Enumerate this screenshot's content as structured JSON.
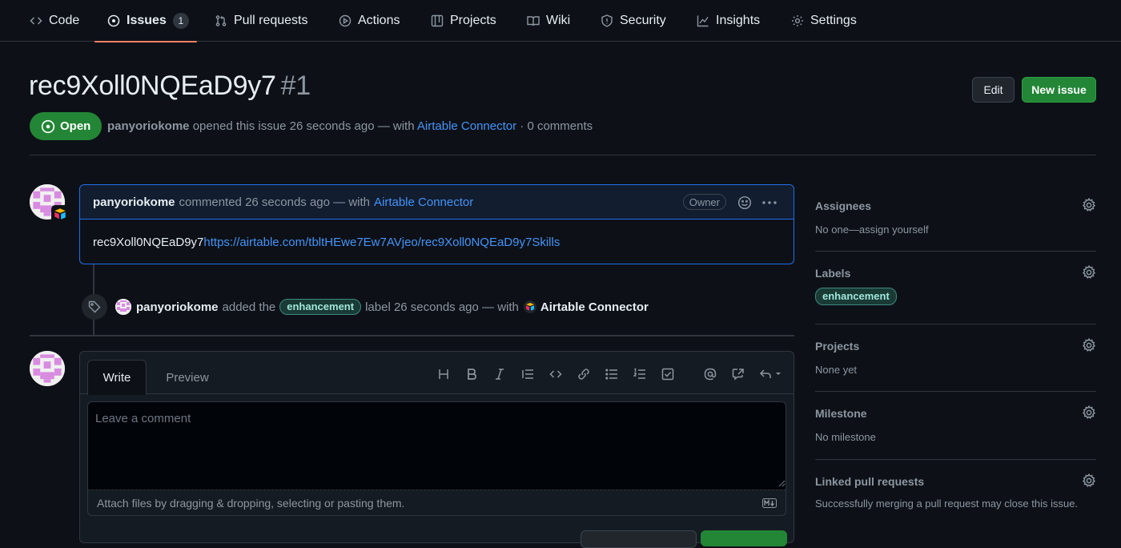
{
  "nav": {
    "items": [
      {
        "label": "Code"
      },
      {
        "label": "Issues",
        "count": "1"
      },
      {
        "label": "Pull requests"
      },
      {
        "label": "Actions"
      },
      {
        "label": "Projects"
      },
      {
        "label": "Wiki"
      },
      {
        "label": "Security"
      },
      {
        "label": "Insights"
      },
      {
        "label": "Settings"
      }
    ],
    "selected": "Issues"
  },
  "issue": {
    "title": "rec9Xoll0NQEaD9y7",
    "number": "#1",
    "state": "Open",
    "author": "panyoriokome",
    "opened_text": "opened this issue 26 seconds ago — with",
    "via": "Airtable Connector",
    "comments": "· 0 comments"
  },
  "header_buttons": {
    "edit": "Edit",
    "new_issue": "New issue"
  },
  "comment": {
    "author": "panyoriokome",
    "meta": "commented 26 seconds ago — with",
    "via": "Airtable Connector",
    "role": "Owner",
    "body_text": "rec9Xoll0NQEaD9y7",
    "body_link": "https://airtable.com/tbltHEwe7Ew7AVjeo/rec9Xoll0NQEaD9y7Skills"
  },
  "event": {
    "actor": "panyoriokome",
    "action": "added the",
    "label": "enhancement",
    "suffix": "label 26 seconds ago — with",
    "app": "Airtable Connector"
  },
  "form": {
    "tab_write": "Write",
    "tab_preview": "Preview",
    "placeholder": "Leave a comment",
    "attach_hint": "Attach files by dragging & dropping, selecting or pasting them."
  },
  "sidebar": {
    "assignees": {
      "title": "Assignees",
      "value": "No one—assign yourself"
    },
    "labels": {
      "title": "Labels",
      "value": "enhancement"
    },
    "projects": {
      "title": "Projects",
      "value": "None yet"
    },
    "milestone": {
      "title": "Milestone",
      "value": "No milestone"
    },
    "linked_prs": {
      "title": "Linked pull requests",
      "value": "Successfully merging a pull request may close this issue."
    }
  },
  "colors": {
    "background": "#0d1117",
    "accent_blue": "#4493f8",
    "open_green": "#238636",
    "tab_underline": "#f78166",
    "label_green": "#1a3a36"
  }
}
